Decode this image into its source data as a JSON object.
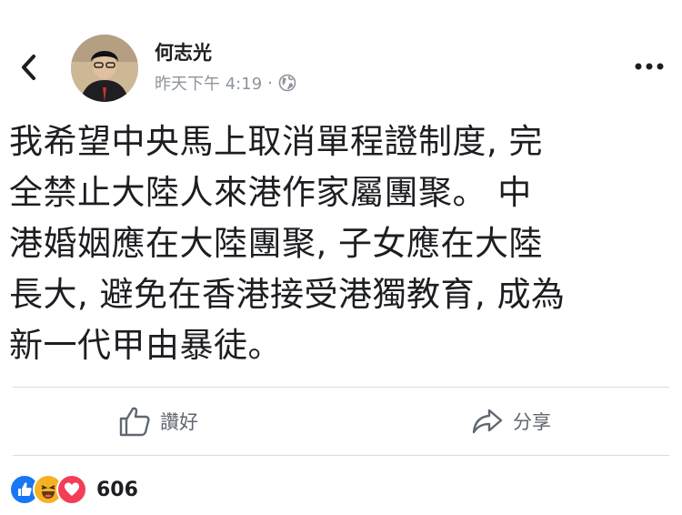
{
  "post": {
    "author": "何志光",
    "timestamp": "昨天下午 4:19",
    "separator": "·",
    "privacy_icon": "globe-icon",
    "body_lines": [
      "我希望中央馬上取消單程證制度, 完",
      "全禁止大陸人來港作家屬團聚。 中",
      "港婚姻應在大陸團聚, 子女應在大陸",
      "長大, 避免在香港接受港獨教育, 成為",
      "新一代甲由暴徒。"
    ]
  },
  "actions": {
    "like_label": "讚好",
    "share_label": "分享"
  },
  "reactions": {
    "icons": [
      "like-reaction-icon",
      "haha-reaction-icon",
      "love-reaction-icon"
    ],
    "count": "606"
  },
  "colors": {
    "text": "#1c1e21",
    "meta": "#8d949e",
    "action": "#606770",
    "like_blue": "#1877f2",
    "love_red": "#f33e58",
    "haha_yellow": "#f7b125"
  }
}
